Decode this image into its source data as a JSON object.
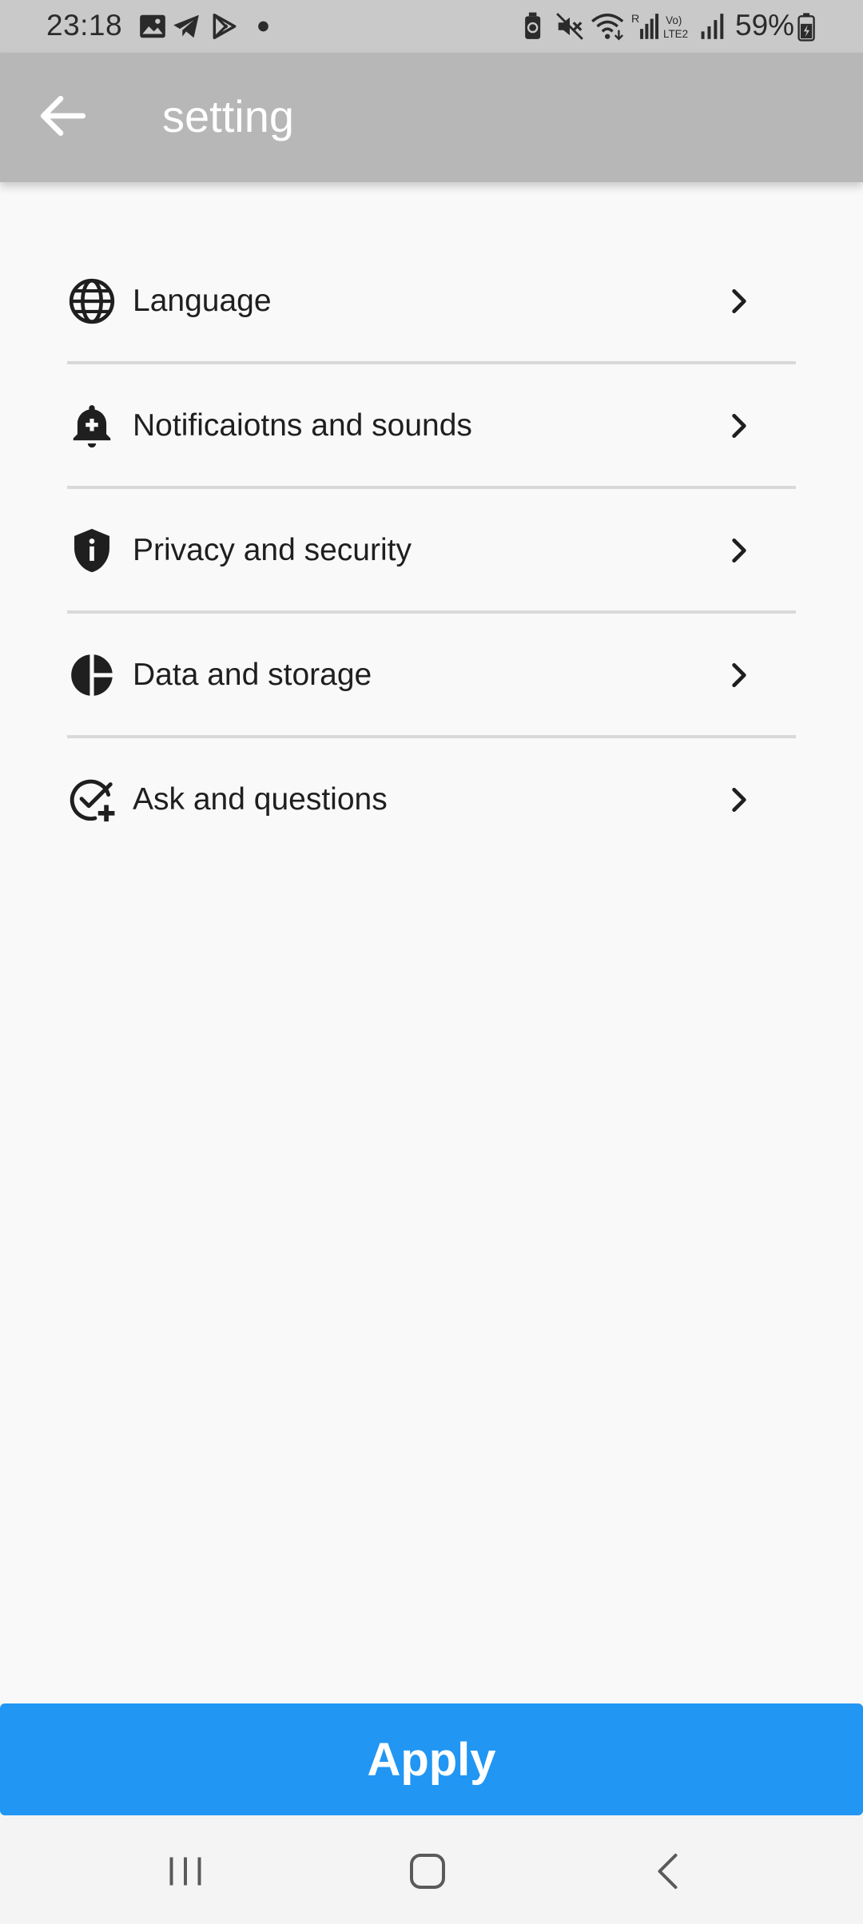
{
  "status_bar": {
    "time": "23:18",
    "battery": "59%",
    "icons": [
      "gallery-icon",
      "telegram-icon",
      "play-store-icon",
      "dot-icon",
      "battery-saver-icon",
      "mute-icon",
      "wifi-icon",
      "signal-r-icon",
      "volte-lte2-icon",
      "signal-icon",
      "battery-icon"
    ]
  },
  "app_bar": {
    "title": "setting",
    "back_icon": "arrow-left-icon"
  },
  "settings": {
    "items": [
      {
        "label": "Language",
        "icon": "globe-icon"
      },
      {
        "label": "Notificaiotns and sounds",
        "icon": "bell-plus-icon"
      },
      {
        "label": "Privacy and security",
        "icon": "shield-info-icon"
      },
      {
        "label": "Data and storage",
        "icon": "pie-chart-icon"
      },
      {
        "label": "Ask and questions",
        "icon": "check-circle-plus-icon"
      }
    ],
    "chevron_icon": "chevron-right-icon"
  },
  "apply_button": {
    "label": "Apply",
    "color": "#2196f3"
  },
  "colors": {
    "app_bar": "#b7b7b7",
    "status_bar": "#c9c9c9",
    "background": "#f9f9f9",
    "divider": "#d9d9d9"
  },
  "nav_bar": {
    "buttons": [
      "recent-apps-icon",
      "home-icon",
      "back-icon"
    ]
  }
}
